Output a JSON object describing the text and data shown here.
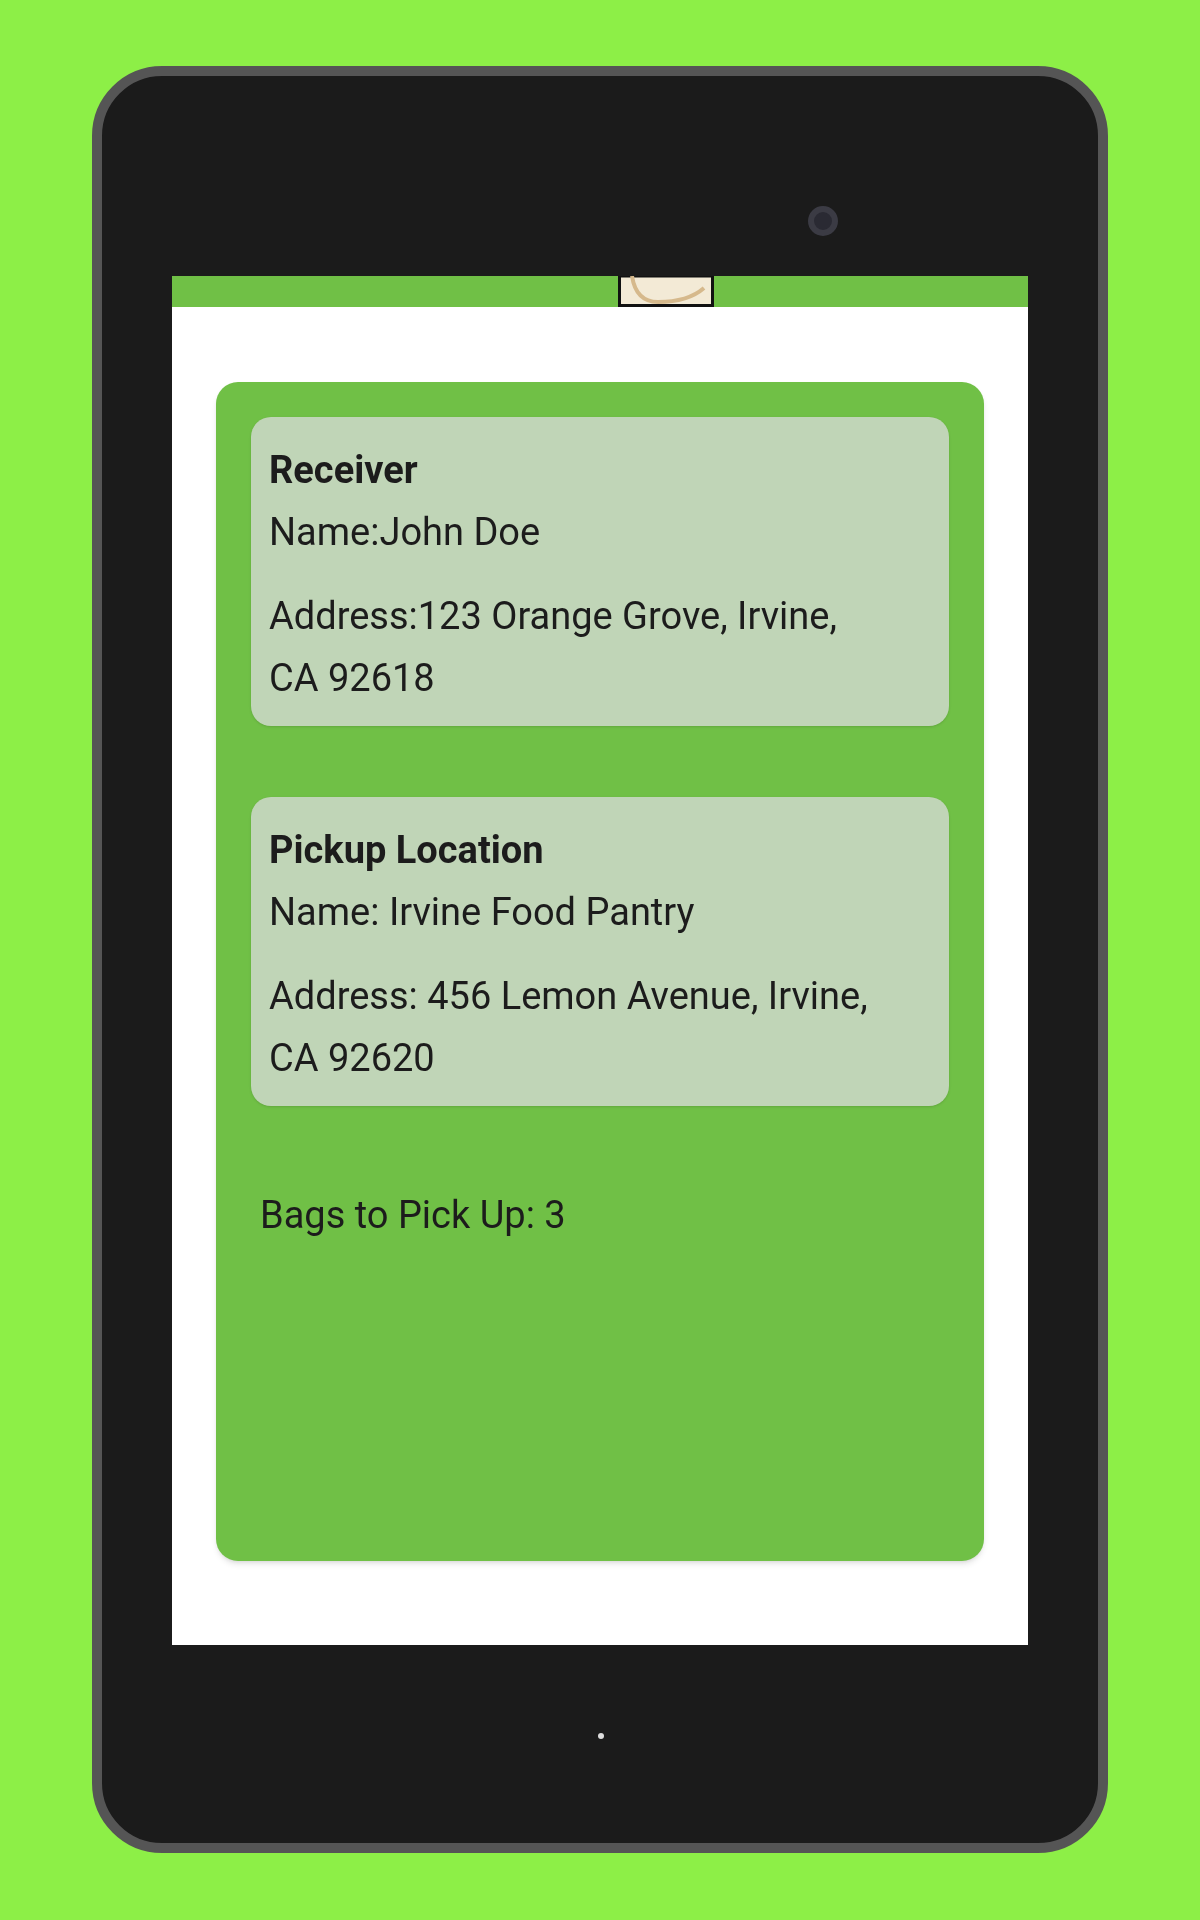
{
  "receiver": {
    "title": "Receiver",
    "name": "Name:John Doe",
    "address": "Address:123 Orange Grove, Irvine, CA 92618"
  },
  "pickup": {
    "title": "Pickup Location",
    "name": "Name: Irvine Food Pantry",
    "address": "Address: 456 Lemon Avenue, Irvine, CA 92620"
  },
  "bags": "Bags to Pick Up: 3"
}
